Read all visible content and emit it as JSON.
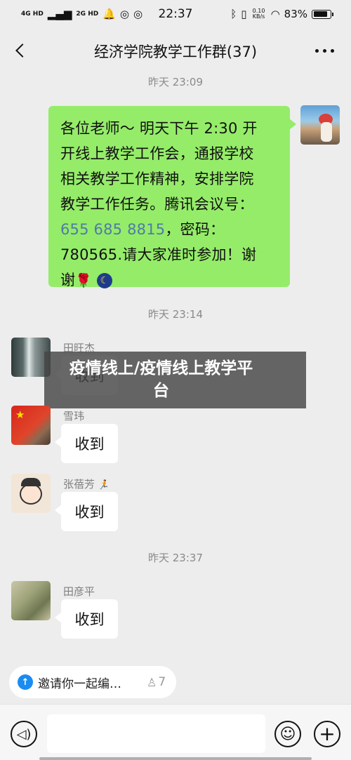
{
  "status_bar": {
    "network_1": "4G HD",
    "network_2": "2G HD",
    "time": "22:37",
    "speed": "0.10 KB/s",
    "battery": "83%",
    "battery_level": 0.83,
    "icons": [
      "signal-icon",
      "notification-icon",
      "qq-icon",
      "qq-icon",
      "bluetooth-icon",
      "vibrate-icon",
      "wifi-icon",
      "battery-icon"
    ]
  },
  "header": {
    "title": "经济学院教学工作群(37)"
  },
  "messages": {
    "sep1": "昨天 23:09",
    "teacher_msg": {
      "line1": "各位老师～ 明天下午 2:30 开",
      "line2": "开线上教学工作会，通报学校",
      "line3": "相关教学工作精神，安排学院",
      "line4": "教学工作任务。腾讯会议号：",
      "meeting_id": "655 685 8815",
      "line5_rest": "，密码：",
      "line6": "780565.请大家准时参加！谢",
      "line7": "谢"
    },
    "sep2": "昨天 23:14",
    "m1_name": "田旺杰",
    "m1_text": "收到",
    "m2_name": "雪玮",
    "m2_text": "收到",
    "m3_name": "张蓓芳",
    "m3_text": "收到",
    "sep3": "昨天 23:37",
    "m4_name": "田彦平",
    "m4_text": "收到"
  },
  "overlay": {
    "line1": "疫情线上/疫情线上教学平",
    "line2": "台"
  },
  "pinned": {
    "text": "邀请你一起编…",
    "count": "7"
  },
  "colors": {
    "sent_bubble": "#95ec69",
    "background": "#ededed",
    "link": "#4f7aa8"
  }
}
